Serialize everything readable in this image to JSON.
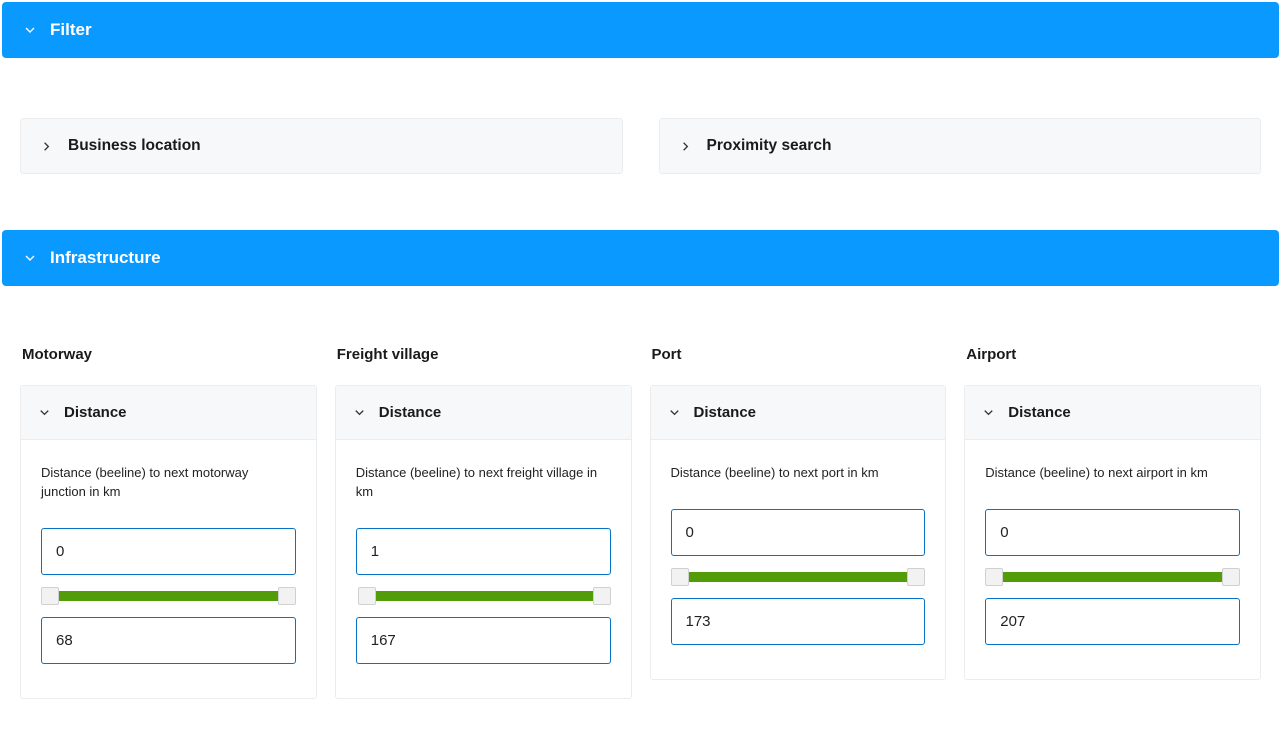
{
  "filter": {
    "title": "Filter",
    "business_location_label": "Business location",
    "proximity_search_label": "Proximity search"
  },
  "infrastructure": {
    "title": "Infrastructure",
    "columns": [
      {
        "title": "Motorway",
        "distance_label": "Distance",
        "desc": "Distance (beeline) to next motorway junction in km",
        "min": "0",
        "max": "68"
      },
      {
        "title": "Freight village",
        "distance_label": "Distance",
        "desc": "Distance (beeline) to next freight village in km",
        "min": "1",
        "max": "167"
      },
      {
        "title": "Port",
        "distance_label": "Distance",
        "desc": "Distance (beeline) to next port in km",
        "min": "0",
        "max": "173"
      },
      {
        "title": "Airport",
        "distance_label": "Distance",
        "desc": "Distance (beeline) to next airport in km",
        "min": "0",
        "max": "207"
      }
    ]
  }
}
